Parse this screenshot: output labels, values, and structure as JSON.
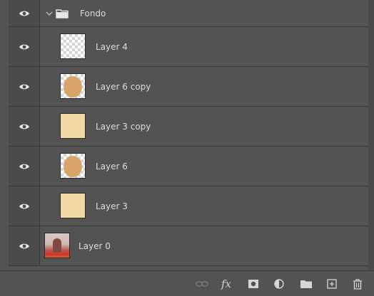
{
  "panel": {
    "group": {
      "name": "Fondo",
      "expanded": true
    },
    "layers": [
      {
        "name": "Layer 4",
        "thumb": "transparent"
      },
      {
        "name": "Layer 6 copy",
        "thumb": "oval-on-transparent"
      },
      {
        "name": "Layer 3 copy",
        "thumb": "pale-solid"
      },
      {
        "name": "Layer 6",
        "thumb": "oval-on-transparent"
      },
      {
        "name": "Layer 3",
        "thumb": "pale-solid"
      }
    ],
    "bottom_layer": {
      "name": "Layer 0",
      "thumb": "photo"
    }
  },
  "toolbar": {
    "fx_label": "fx",
    "icons": [
      "link-layers-icon",
      "fx-icon",
      "mask-icon",
      "adjustment-icon",
      "folder-icon",
      "new-layer-icon",
      "trash-icon"
    ]
  },
  "colors": {
    "panel_bg": "#535353",
    "eye_column": "#4b4b4b",
    "divider": "#3a3a3a",
    "text": "#dcdcdc",
    "oval_fill": "#d7a469",
    "pale_fill": "#f2d8a4"
  }
}
